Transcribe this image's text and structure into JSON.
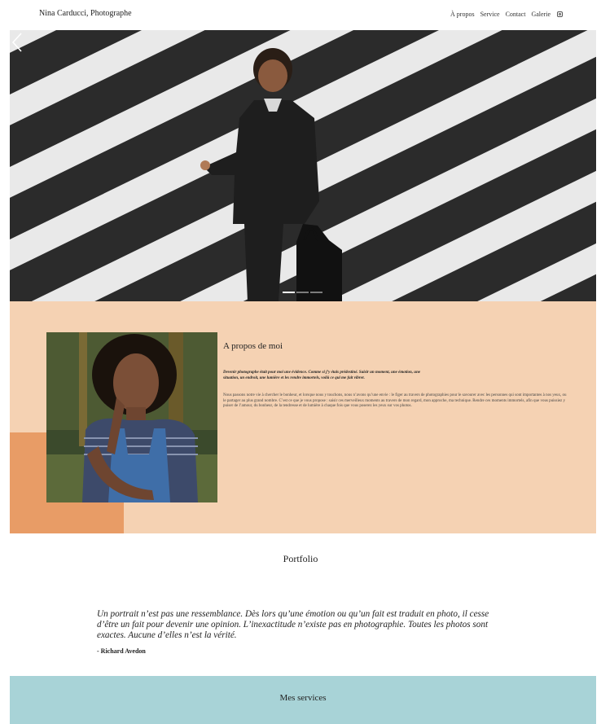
{
  "header": {
    "site_title": "Nina Carducci, Photographe",
    "nav": [
      "À propos",
      "Service",
      "Contact",
      "Galerie"
    ],
    "instagram_icon": "instagram-icon"
  },
  "hero": {
    "slides_count": 3,
    "active_slide": 1,
    "prev_icon": "chevron-left-icon"
  },
  "about": {
    "title": "A propos de moi",
    "lead": "Devenir photographe était pour moi une évidence. Comme si j’y étais prédestiné. Saisir un moment, une émotion, une situation, un endroit, une lumière et les rendre immortels, voilà ce qui me fait vibrer.",
    "body": "Nous passons notre vie à chercher le bonheur, et lorsque nous y touchons, nous n’avons qu’une envie : le figer au travers de photographies pour le savourer avec les personnes qui sont importantes à nos yeux, ou le partager au plus grand nombre. C’est ce que je vous propose : saisir ces merveilleux moments au travers de mon regard, mon approche, ma technique. Rendre ces moments immortels, afin que vous puissiez y puiser de l’amour, du bonheur, de la tendresse et de lumière à chaque fois que vous poserez les yeux sur vos photos."
  },
  "portfolio": {
    "title": "Portfolio",
    "quote": "Un portrait n’est pas une ressemblance. Dès lors qu’une émotion ou qu’un fait est traduit en photo, il cesse d’être un fait pour devenir une opinion. L’inexactitude n’existe pas en photographie. Toutes les photos sont exactes. Aucune d’elles n’est la vérité.",
    "author": "- Richard Avedon"
  },
  "services": {
    "title": "Mes services"
  },
  "colors": {
    "about_bg": "#f5d2b3",
    "about_accent": "#e89c66",
    "services_bg": "#a8d3d7"
  }
}
